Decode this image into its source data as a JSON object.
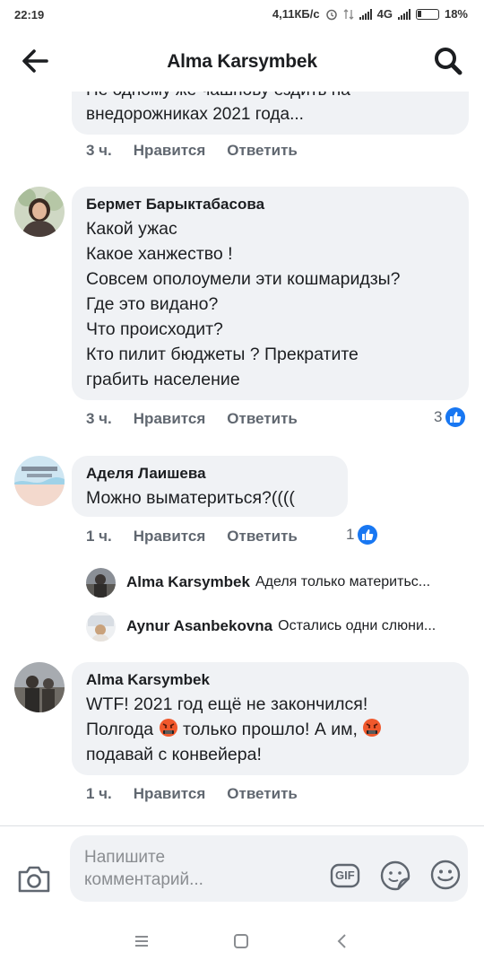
{
  "status_bar": {
    "time": "22:19",
    "net_speed": "4,11КБ/с",
    "network": "4G",
    "battery": "18%"
  },
  "header": {
    "title": "Alma Karsymbek"
  },
  "cut_comment": {
    "lines": [
      "Не одному же чашнову ездить на",
      "внедорожниках 2021 года..."
    ],
    "time": "3 ч.",
    "like_label": "Нравится",
    "reply_label": "Ответить"
  },
  "comments": [
    {
      "author": "Бермет Барыктабасова",
      "lines": [
        "Какой ужас",
        "Какое ханжество !",
        "Совсем ополоумели эти кошмаридзы?",
        "Где это видано?",
        "Что происходит?",
        "Кто пилит бюджеты ? Прекратите",
        "грабить население"
      ],
      "time": "3 ч.",
      "like_label": "Нравится",
      "reply_label": "Ответить",
      "likes": "3"
    },
    {
      "author": "Аделя Лаишева",
      "lines": [
        "Можно выматериться?(((("
      ],
      "time": "1 ч.",
      "like_label": "Нравится",
      "reply_label": "Ответить",
      "likes": "1",
      "replies": [
        {
          "author": "Alma Karsymbek",
          "text": "Аделя только материтьс..."
        },
        {
          "author": "Aynur Asanbekovna",
          "text": "Остались одни слюни..."
        }
      ]
    },
    {
      "author": "Alma Karsymbek",
      "line1": "WTF! 2021 год ещё не закончился!",
      "line2_a": "Полгода",
      "line2_b": "только прошло! А им,",
      "line3": "подавай с конвейера!",
      "time": "1 ч.",
      "like_label": "Нравится",
      "reply_label": "Ответить"
    }
  ],
  "composer": {
    "placeholder_line1": "Напишите",
    "placeholder_line2": "комментарий...",
    "gif_label": "GIF"
  },
  "icons": {
    "back": "arrow-left-icon",
    "search": "search-icon",
    "camera": "camera-icon",
    "gif": "gif-icon",
    "sticker": "sticker-icon",
    "emoji": "smiley-icon",
    "like": "thumbs-up-icon",
    "angry_emoji": "angry-face-icon"
  },
  "colors": {
    "accent": "#1877f2",
    "bubble": "#f0f2f5",
    "secondary_text": "#606770"
  }
}
